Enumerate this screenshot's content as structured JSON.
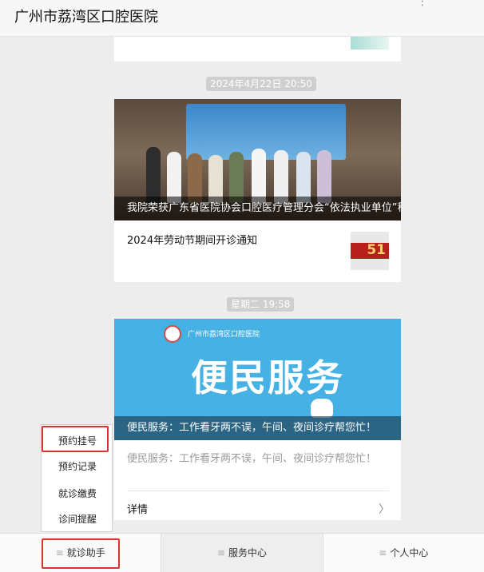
{
  "header": {
    "title": "广州市荔湾区口腔医院",
    "more": "⋮"
  },
  "timestamps": [
    "2024年4月22日 20:50",
    "星期二 19:58"
  ],
  "article1": {
    "caption": "我院荣获广东省医院协会口腔医疗管理分会“依法执业单位”称号",
    "sub_title": "2024年劳动节期间开诊通知",
    "thumb_number": "51"
  },
  "article2": {
    "banner_brand": "广州市荔湾区口腔医院",
    "banner_title": "便民服务",
    "caption": "便民服务：工作看牙两不误，午间、夜间诊疗帮您忙！",
    "description": "便民服务：工作看牙两不误，午间、夜间诊疗帮您忙！",
    "detail_label": "详情",
    "chevron": "〉"
  },
  "menu": {
    "items": [
      "预约挂号",
      "预约记录",
      "就诊缴费",
      "诊间提醒"
    ]
  },
  "tabs": [
    {
      "label": "就诊助手",
      "icon": "≡"
    },
    {
      "label": "服务中心",
      "icon": "≡"
    },
    {
      "label": "个人中心",
      "icon": "≡"
    }
  ]
}
